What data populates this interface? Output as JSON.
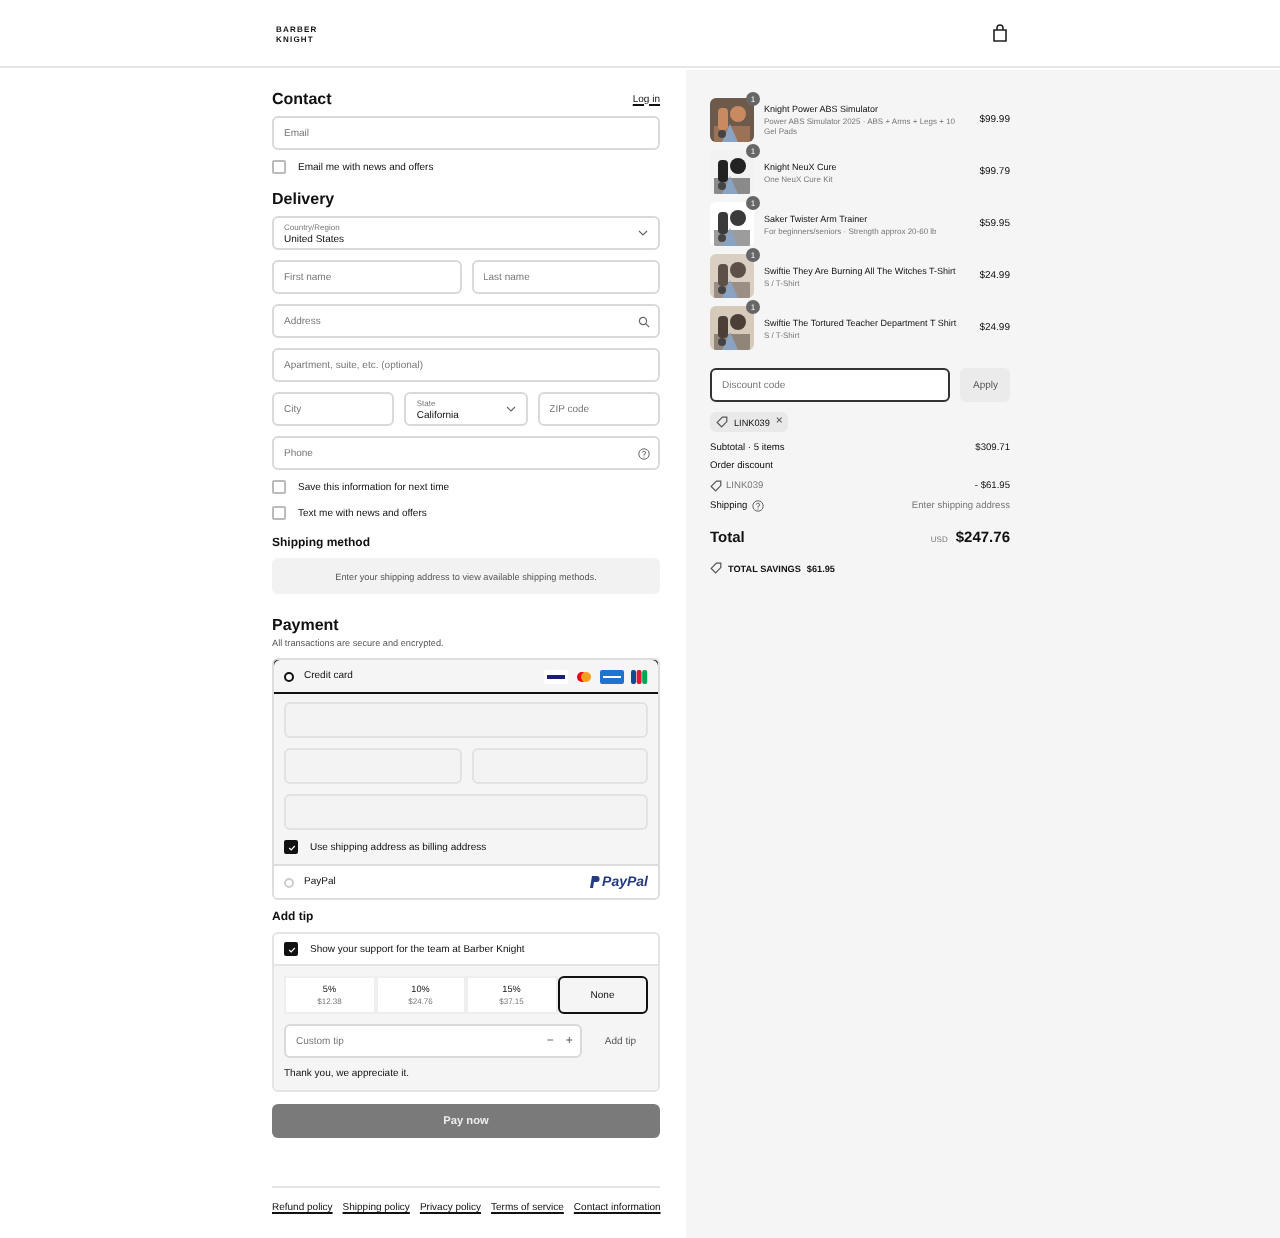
{
  "header": {
    "logo": [
      "BARBER",
      "KNIGHT"
    ]
  },
  "contact": {
    "title": "Contact",
    "login": "Log in",
    "email": {
      "placeholder": "Email"
    },
    "news": {
      "label": "Email me with news and offers",
      "checked": false
    }
  },
  "delivery": {
    "title": "Delivery",
    "country": {
      "label": "Country/Region",
      "value": "United States"
    },
    "first_name": {
      "placeholder": "First name"
    },
    "last_name": {
      "placeholder": "Last name"
    },
    "address": {
      "placeholder": "Address"
    },
    "apartment": {
      "placeholder": "Apartment, suite, etc. (optional)"
    },
    "city": {
      "placeholder": "City"
    },
    "state": {
      "label": "State",
      "value": "California"
    },
    "zip": {
      "placeholder": "ZIP code"
    },
    "phone": {
      "placeholder": "Phone"
    },
    "options": [
      {
        "label": "Save this information for next time",
        "checked": false
      },
      {
        "label": "Text me with news and offers",
        "checked": false
      }
    ]
  },
  "shipping_method": {
    "title": "Shipping method",
    "message": "Enter your shipping address to view available shipping methods."
  },
  "payment": {
    "title": "Payment",
    "subtitle": "All transactions are secure and encrypted.",
    "methods": [
      {
        "kind": "card",
        "label": "Credit card",
        "selected": true
      },
      {
        "kind": "paypal",
        "label": "PayPal",
        "logo": "PayPal",
        "selected": false
      }
    ],
    "billing": {
      "label": "Use shipping address as billing address",
      "checked": true
    }
  },
  "tip": {
    "title": "Add tip",
    "support": {
      "label": "Show your support for the team at Barber Knight",
      "checked": true
    },
    "options": [
      {
        "label": "5%",
        "amount": "$12.38",
        "selected": false
      },
      {
        "label": "10%",
        "amount": "$24.76",
        "selected": false
      },
      {
        "label": "15%",
        "amount": "$37.15",
        "selected": false
      },
      {
        "label": "None",
        "selected": true
      }
    ],
    "custom": {
      "placeholder": "Custom tip",
      "minus": "−",
      "plus": "+"
    },
    "add": "Add tip",
    "thanks": "Thank you, we appreciate it."
  },
  "pay_button": "Pay now",
  "footer_links": [
    "Refund policy",
    "Shipping policy",
    "Privacy policy",
    "Terms of service",
    "Contact information"
  ],
  "summary": {
    "items": [
      {
        "qty": "1",
        "name": "Knight Power ABS Simulator",
        "variant": "Power ABS Simulator 2025 · ABS + Arms + Legs + 10 Gel Pads",
        "price": "$99.99"
      },
      {
        "qty": "1",
        "name": "Knight NeuX Cure",
        "variant": "One NeuX Cure Kit",
        "price": "$99.79"
      },
      {
        "qty": "1",
        "name": "Saker Twister Arm Trainer",
        "variant": "For beginners/seniors · Strength approx 20-60 lb",
        "price": "$59.95"
      },
      {
        "qty": "1",
        "name": "Swiftie They Are Burning All The Witches T-Shirt",
        "variant": "S / T-Shirt",
        "price": "$24.99"
      },
      {
        "qty": "1",
        "name": "Swiftie The Tortured Teacher Department T Shirt",
        "variant": "S / T-Shirt",
        "price": "$24.99"
      }
    ],
    "discount": {
      "placeholder": "Discount code",
      "apply": "Apply",
      "code": "LINK039",
      "remove": "×"
    },
    "subtotal": {
      "label": "Subtotal · 5 items",
      "value": "$309.71"
    },
    "order_discount": {
      "label": "Order discount",
      "code": "LINK039",
      "value": "- $61.95"
    },
    "shipping": {
      "label": "Shipping",
      "value": "Enter shipping address"
    },
    "total": {
      "label": "Total",
      "currency": "USD",
      "value": "$247.76"
    },
    "savings": {
      "label": "TOTAL SAVINGS",
      "value": "$61.95"
    }
  }
}
